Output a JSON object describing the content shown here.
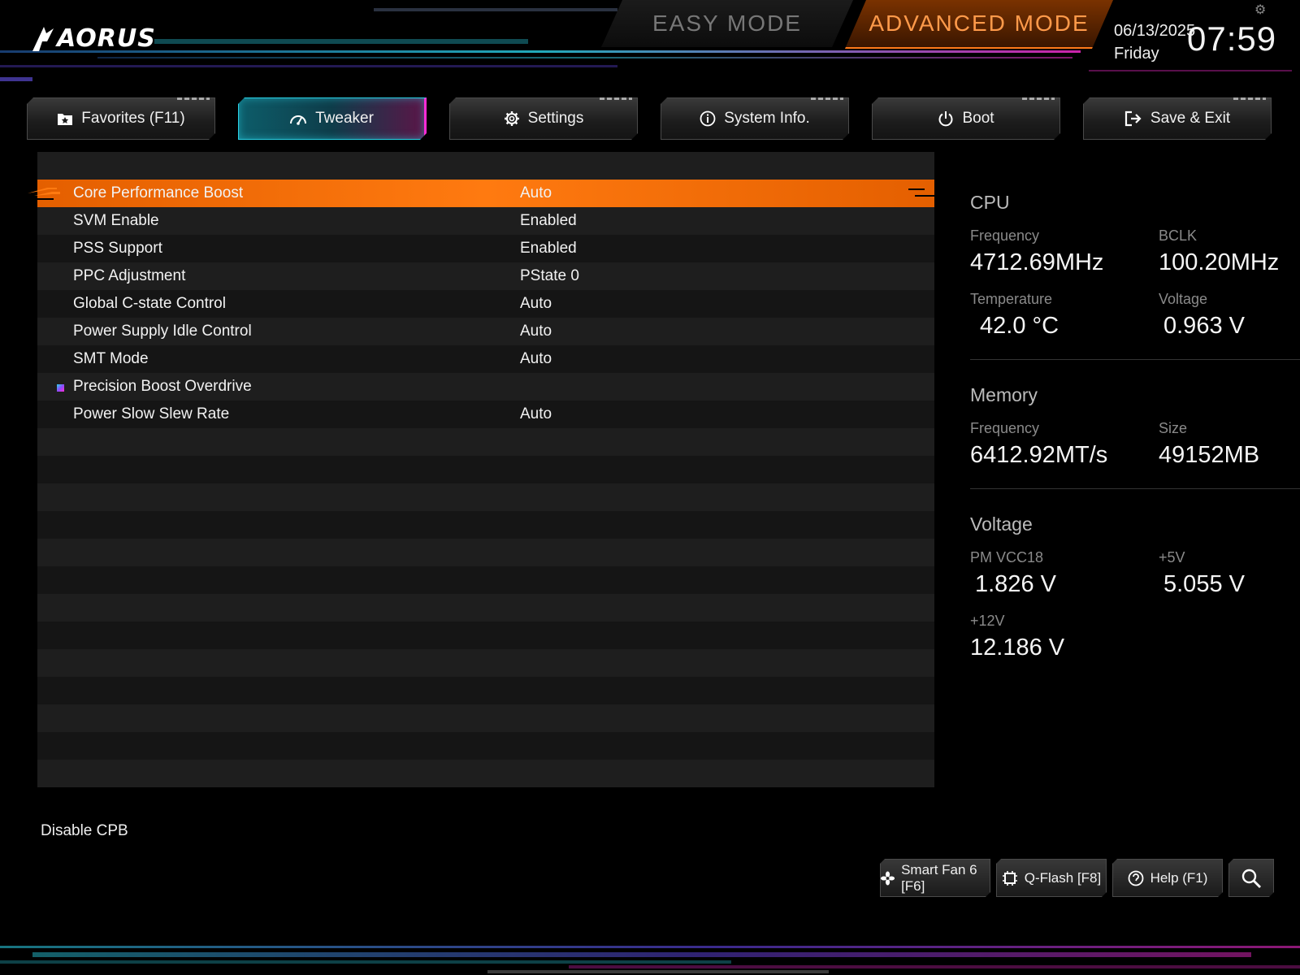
{
  "header": {
    "logo_text": "AORUS",
    "easy_mode_label": "EASY MODE",
    "advanced_mode_label": "ADVANCED MODE",
    "date": "06/13/2025",
    "weekday": "Friday",
    "time": "07:59"
  },
  "tabs": [
    {
      "label": "Favorites (F11)",
      "icon": "favorites-icon",
      "active": false
    },
    {
      "label": "Tweaker",
      "icon": "gauge-icon",
      "active": true
    },
    {
      "label": "Settings",
      "icon": "gear-icon",
      "active": false
    },
    {
      "label": "System Info.",
      "icon": "info-icon",
      "active": false
    },
    {
      "label": "Boot",
      "icon": "power-icon",
      "active": false
    },
    {
      "label": "Save & Exit",
      "icon": "exit-icon",
      "active": false
    }
  ],
  "settings": [
    {
      "label": "Core Performance Boost",
      "value": "Auto",
      "selected": true
    },
    {
      "label": "SVM Enable",
      "value": "Enabled"
    },
    {
      "label": "PSS Support",
      "value": "Enabled"
    },
    {
      "label": "PPC Adjustment",
      "value": "PState 0"
    },
    {
      "label": "Global C-state Control",
      "value": "Auto"
    },
    {
      "label": "Power Supply Idle Control",
      "value": "Auto"
    },
    {
      "label": "SMT Mode",
      "value": "Auto"
    },
    {
      "label": "Precision Boost Overdrive",
      "value": "",
      "submenu": true
    },
    {
      "label": "Power Slow Slew Rate",
      "value": "Auto"
    }
  ],
  "panel": {
    "cpu": {
      "title": "CPU",
      "frequency_label": "Frequency",
      "frequency": "4712.69MHz",
      "bclk_label": "BCLK",
      "bclk": "100.20MHz",
      "temperature_label": "Temperature",
      "temperature": "42.0 °C",
      "voltage_label": "Voltage",
      "voltage": "0.963 V"
    },
    "memory": {
      "title": "Memory",
      "frequency_label": "Frequency",
      "frequency": "6412.92MT/s",
      "size_label": "Size",
      "size": "49152MB"
    },
    "voltage": {
      "title": "Voltage",
      "pm_vcc18_label": "PM VCC18",
      "pm_vcc18": "1.826 V",
      "plus5v_label": "+5V",
      "plus5v": "5.055 V",
      "plus12v_label": "+12V",
      "plus12v": "12.186 V"
    }
  },
  "footer": {
    "help_text": "Disable CPB",
    "smart_fan_label": "Smart Fan 6 [F6]",
    "qflash_label": "Q-Flash [F8]",
    "help_label": "Help (F1)"
  },
  "colors": {
    "accent_orange": "#ff7a10",
    "accent_cyan": "#2ad4e8",
    "accent_magenta": "#ff2bd6"
  }
}
